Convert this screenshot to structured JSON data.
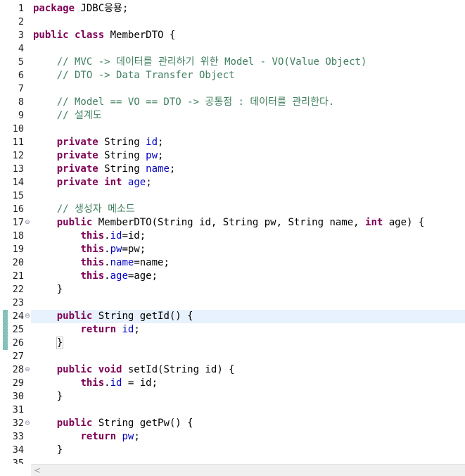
{
  "editor": {
    "scroll_left_label": "<",
    "lines": [
      {
        "n": "1",
        "fold": "",
        "tokens": [
          {
            "t": "package",
            "c": "kw"
          },
          {
            "t": " JDBC응용;",
            "c": ""
          }
        ]
      },
      {
        "n": "2",
        "fold": "",
        "tokens": []
      },
      {
        "n": "3",
        "fold": "",
        "tokens": [
          {
            "t": "public",
            "c": "kw"
          },
          {
            "t": " ",
            "c": ""
          },
          {
            "t": "class",
            "c": "kw"
          },
          {
            "t": " MemberDTO {",
            "c": ""
          }
        ]
      },
      {
        "n": "4",
        "fold": "",
        "tokens": []
      },
      {
        "n": "5",
        "fold": "",
        "tokens": [
          {
            "t": "    // MVC -> 데이터를 관리하기 위한 Model - VO(Value Object)",
            "c": "cm"
          }
        ]
      },
      {
        "n": "6",
        "fold": "",
        "tokens": [
          {
            "t": "    // DTO -> Data Transfer Object",
            "c": "cm"
          }
        ]
      },
      {
        "n": "7",
        "fold": "",
        "tokens": []
      },
      {
        "n": "8",
        "fold": "",
        "tokens": [
          {
            "t": "    // Model == VO == DTO -> 공통점 : 데이터를 관리한다.",
            "c": "cm"
          }
        ]
      },
      {
        "n": "9",
        "fold": "",
        "tokens": [
          {
            "t": "    // 설계도",
            "c": "cm"
          }
        ]
      },
      {
        "n": "10",
        "fold": "",
        "tokens": []
      },
      {
        "n": "11",
        "fold": "",
        "tokens": [
          {
            "t": "    ",
            "c": ""
          },
          {
            "t": "private",
            "c": "kw"
          },
          {
            "t": " String ",
            "c": ""
          },
          {
            "t": "id",
            "c": "fd"
          },
          {
            "t": ";",
            "c": ""
          }
        ]
      },
      {
        "n": "12",
        "fold": "",
        "tokens": [
          {
            "t": "    ",
            "c": ""
          },
          {
            "t": "private",
            "c": "kw"
          },
          {
            "t": " String ",
            "c": ""
          },
          {
            "t": "pw",
            "c": "fd"
          },
          {
            "t": ";",
            "c": ""
          }
        ]
      },
      {
        "n": "13",
        "fold": "",
        "tokens": [
          {
            "t": "    ",
            "c": ""
          },
          {
            "t": "private",
            "c": "kw"
          },
          {
            "t": " String ",
            "c": ""
          },
          {
            "t": "name",
            "c": "fd"
          },
          {
            "t": ";",
            "c": ""
          }
        ]
      },
      {
        "n": "14",
        "fold": "",
        "tokens": [
          {
            "t": "    ",
            "c": ""
          },
          {
            "t": "private",
            "c": "kw"
          },
          {
            "t": " ",
            "c": ""
          },
          {
            "t": "int",
            "c": "kw"
          },
          {
            "t": " ",
            "c": ""
          },
          {
            "t": "age",
            "c": "fd"
          },
          {
            "t": ";",
            "c": ""
          }
        ]
      },
      {
        "n": "15",
        "fold": "",
        "tokens": []
      },
      {
        "n": "16",
        "fold": "",
        "tokens": [
          {
            "t": "    // 생성자 메소드",
            "c": "cm"
          }
        ]
      },
      {
        "n": "17",
        "fold": "⊖",
        "tokens": [
          {
            "t": "    ",
            "c": ""
          },
          {
            "t": "public",
            "c": "kw"
          },
          {
            "t": " MemberDTO(String id, String pw, String name, ",
            "c": ""
          },
          {
            "t": "int",
            "c": "kw"
          },
          {
            "t": " age) {",
            "c": ""
          }
        ]
      },
      {
        "n": "18",
        "fold": "",
        "tokens": [
          {
            "t": "        ",
            "c": ""
          },
          {
            "t": "this",
            "c": "kw"
          },
          {
            "t": ".",
            "c": ""
          },
          {
            "t": "id",
            "c": "fd"
          },
          {
            "t": "=id;",
            "c": ""
          }
        ]
      },
      {
        "n": "19",
        "fold": "",
        "tokens": [
          {
            "t": "        ",
            "c": ""
          },
          {
            "t": "this",
            "c": "kw"
          },
          {
            "t": ".",
            "c": ""
          },
          {
            "t": "pw",
            "c": "fd"
          },
          {
            "t": "=pw;",
            "c": ""
          }
        ]
      },
      {
        "n": "20",
        "fold": "",
        "tokens": [
          {
            "t": "        ",
            "c": ""
          },
          {
            "t": "this",
            "c": "kw"
          },
          {
            "t": ".",
            "c": ""
          },
          {
            "t": "name",
            "c": "fd"
          },
          {
            "t": "=name;",
            "c": ""
          }
        ]
      },
      {
        "n": "21",
        "fold": "",
        "tokens": [
          {
            "t": "        ",
            "c": ""
          },
          {
            "t": "this",
            "c": "kw"
          },
          {
            "t": ".",
            "c": ""
          },
          {
            "t": "age",
            "c": "fd"
          },
          {
            "t": "=age;",
            "c": ""
          }
        ]
      },
      {
        "n": "22",
        "fold": "",
        "tokens": [
          {
            "t": "    }",
            "c": ""
          }
        ]
      },
      {
        "n": "23",
        "fold": "",
        "tokens": []
      },
      {
        "n": "24",
        "fold": "⊖",
        "current": true,
        "tokens": [
          {
            "t": "    ",
            "c": ""
          },
          {
            "t": "public",
            "c": "kw"
          },
          {
            "t": " String getId() {",
            "c": ""
          }
        ]
      },
      {
        "n": "25",
        "fold": "",
        "tokens": [
          {
            "t": "        ",
            "c": ""
          },
          {
            "t": "return",
            "c": "kw"
          },
          {
            "t": " ",
            "c": ""
          },
          {
            "t": "id",
            "c": "fd"
          },
          {
            "t": ";",
            "c": ""
          }
        ]
      },
      {
        "n": "26",
        "fold": "",
        "tokens": [
          {
            "t": "    ",
            "c": ""
          },
          {
            "t": "}",
            "c": "bm"
          }
        ]
      },
      {
        "n": "27",
        "fold": "",
        "tokens": []
      },
      {
        "n": "28",
        "fold": "⊖",
        "tokens": [
          {
            "t": "    ",
            "c": ""
          },
          {
            "t": "public",
            "c": "kw"
          },
          {
            "t": " ",
            "c": ""
          },
          {
            "t": "void",
            "c": "kw"
          },
          {
            "t": " setId(String id) {",
            "c": ""
          }
        ]
      },
      {
        "n": "29",
        "fold": "",
        "tokens": [
          {
            "t": "        ",
            "c": ""
          },
          {
            "t": "this",
            "c": "kw"
          },
          {
            "t": ".",
            "c": ""
          },
          {
            "t": "id",
            "c": "fd"
          },
          {
            "t": " = id;",
            "c": ""
          }
        ]
      },
      {
        "n": "30",
        "fold": "",
        "tokens": [
          {
            "t": "    }",
            "c": ""
          }
        ]
      },
      {
        "n": "31",
        "fold": "",
        "tokens": []
      },
      {
        "n": "32",
        "fold": "⊖",
        "tokens": [
          {
            "t": "    ",
            "c": ""
          },
          {
            "t": "public",
            "c": "kw"
          },
          {
            "t": " String getPw() {",
            "c": ""
          }
        ]
      },
      {
        "n": "33",
        "fold": "",
        "tokens": [
          {
            "t": "        ",
            "c": ""
          },
          {
            "t": "return",
            "c": "kw"
          },
          {
            "t": " ",
            "c": ""
          },
          {
            "t": "pw",
            "c": "fd"
          },
          {
            "t": ";",
            "c": ""
          }
        ]
      },
      {
        "n": "34",
        "fold": "",
        "tokens": [
          {
            "t": "    }",
            "c": ""
          }
        ]
      },
      {
        "n": "35",
        "fold": "",
        "tokens": []
      }
    ]
  }
}
